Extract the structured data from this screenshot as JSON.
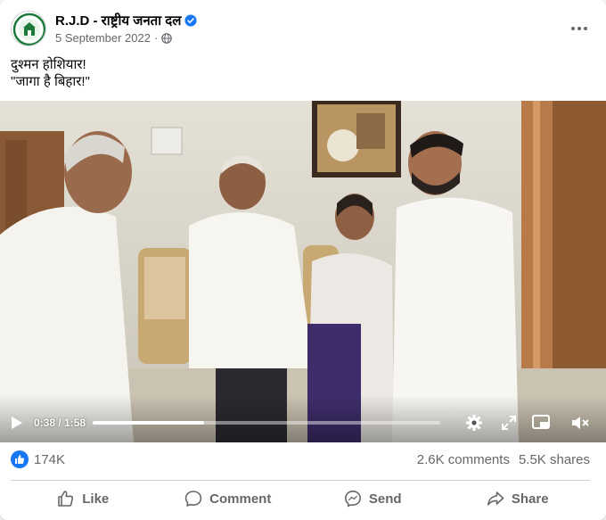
{
  "post": {
    "page_name": "R.J.D - राष्ट्रीय जनता दल",
    "date": "5 September 2022",
    "separator": "·",
    "text_lines": [
      "दुश्मन होशियार!",
      "\"जागा है बिहार!\""
    ]
  },
  "video": {
    "time_display": "0:38 / 1:58",
    "progress": 0.32
  },
  "stats": {
    "reactions_count": "174K",
    "comments": "2.6K comments",
    "shares": "5.5K shares"
  },
  "actions": {
    "like": "Like",
    "comment": "Comment",
    "send": "Send",
    "share": "Share"
  },
  "colors": {
    "accent": "#1877f2",
    "secondary_text": "#65676b",
    "avatar_green": "#1b7a3a"
  },
  "icons": [
    "verified-badge-icon",
    "globe-icon",
    "more-icon",
    "play-icon",
    "settings-icon",
    "fullscreen-icon",
    "miniplayer-icon",
    "volume-icon",
    "like-reaction-icon",
    "like-icon",
    "comment-icon",
    "send-icon",
    "share-icon"
  ]
}
